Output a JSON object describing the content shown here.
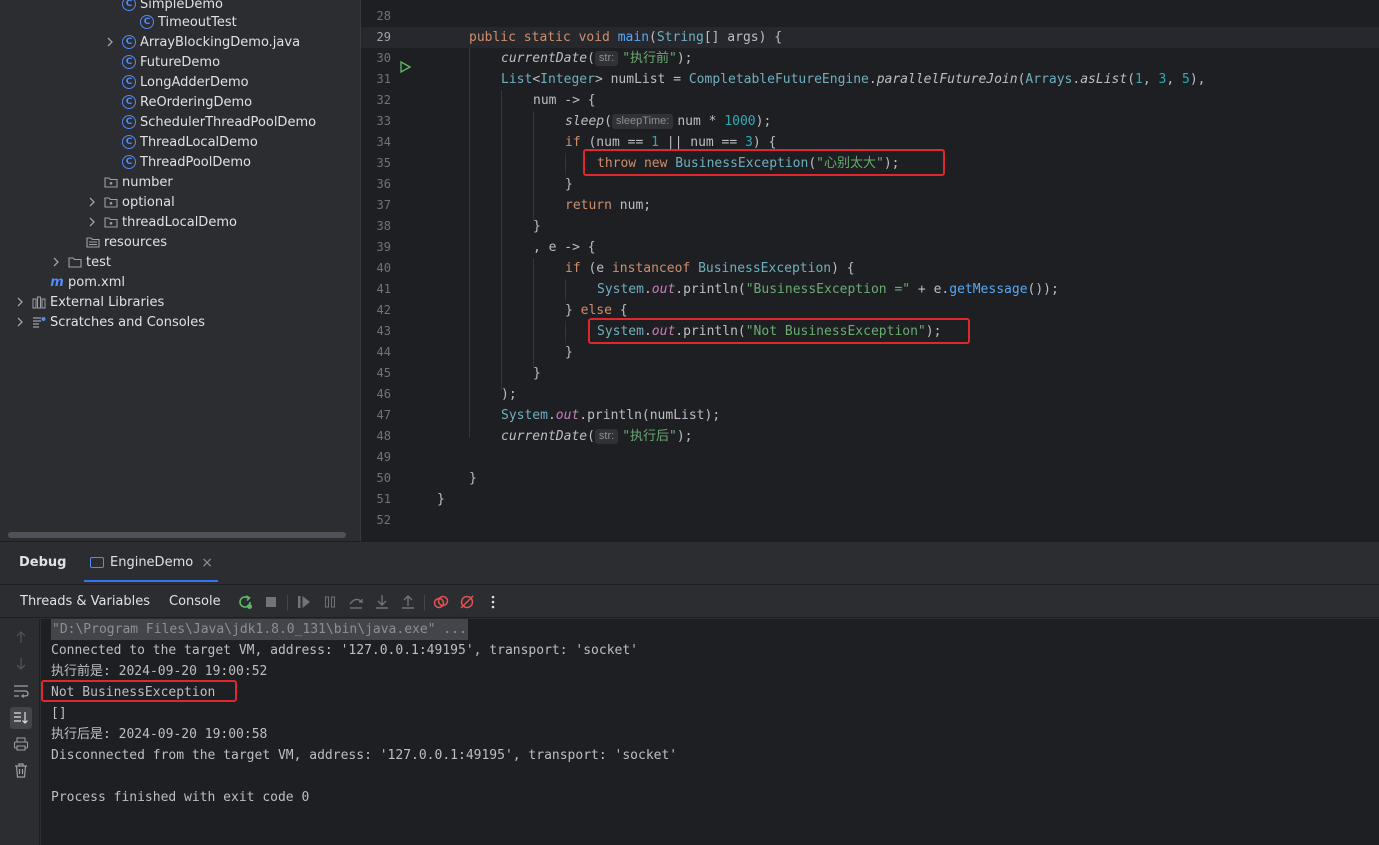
{
  "project_tree": {
    "items": [
      {
        "label": "SimpleDemo",
        "type": "class"
      },
      {
        "label": "TimeoutTest",
        "type": "class"
      },
      {
        "label": "ArrayBlockingDemo.java",
        "type": "class"
      },
      {
        "label": "FutureDemo",
        "type": "class"
      },
      {
        "label": "LongAdderDemo",
        "type": "class"
      },
      {
        "label": "ReOrderingDemo",
        "type": "class"
      },
      {
        "label": "SchedulerThreadPoolDemo",
        "type": "class"
      },
      {
        "label": "ThreadLocalDemo",
        "type": "class"
      },
      {
        "label": "ThreadPoolDemo",
        "type": "class"
      },
      {
        "label": "number",
        "type": "package"
      },
      {
        "label": "optional",
        "type": "package"
      },
      {
        "label": "threadLocalDemo",
        "type": "package"
      },
      {
        "label": "resources",
        "type": "resources-folder"
      },
      {
        "label": "test",
        "type": "folder"
      },
      {
        "label": "pom.xml",
        "type": "maven-file"
      },
      {
        "label": "External Libraries",
        "type": "libraries"
      },
      {
        "label": "Scratches and Consoles",
        "type": "scratches"
      }
    ]
  },
  "editor": {
    "line_numbers": [
      "28",
      "29",
      "30",
      "31",
      "32",
      "33",
      "34",
      "35",
      "36",
      "37",
      "38",
      "39",
      "40",
      "41",
      "42",
      "43",
      "44",
      "45",
      "46",
      "47",
      "48",
      "49",
      "50",
      "51",
      "52"
    ],
    "current_line": "29",
    "hints": {
      "str": "str:",
      "sleep_time": "sleepTime:"
    },
    "strings": {
      "before": "\"执行前\"",
      "exception_msg": "\"心别太大\"",
      "business_prefix": "\"BusinessException =\"",
      "not_business": "\"Not BusinessException\"",
      "after": "\"执行后\""
    },
    "numbers": {
      "n1": "1",
      "n3": "3",
      "n5": "5",
      "n1000": "1000"
    }
  },
  "debug": {
    "title": "Debug",
    "run_tab": "EngineDemo",
    "tabs": [
      "Threads & Variables",
      "Console"
    ],
    "console_lines": [
      "\"D:\\Program Files\\Java\\jdk1.8.0_131\\bin\\java.exe\" ...",
      "Connected to the target VM, address: '127.0.0.1:49195', transport: 'socket'",
      "执行前是: 2024-09-20 19:00:52",
      "Not BusinessException",
      "[]",
      "执行后是: 2024-09-20 19:00:58",
      "Disconnected from the target VM, address: '127.0.0.1:49195', transport: 'socket'",
      "",
      "Process finished with exit code 0"
    ]
  },
  "colors": {
    "accent": "#3574f0",
    "highlight_box": "#e0272d",
    "keyword": "#cf8e6d",
    "string": "#6aab73",
    "number": "#2aacb8",
    "method": "#56a8f5"
  }
}
